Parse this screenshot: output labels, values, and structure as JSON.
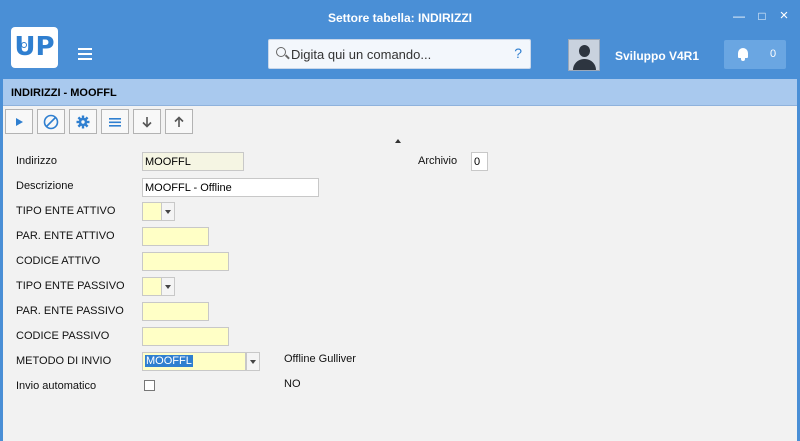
{
  "window": {
    "title": "Settore tabella: INDIRIZZI"
  },
  "header": {
    "logo": "UP",
    "command_placeholder": "Digita qui un comando...",
    "help": "?",
    "user": "Sviluppo V4R1",
    "notifications_count": "0"
  },
  "panel": {
    "title": "INDIRIZZI - MOOFFL"
  },
  "toolbar": {
    "icons": [
      "play-icon",
      "cancel-icon",
      "gear-icon",
      "list-icon",
      "arrow-down-icon",
      "arrow-up-icon"
    ]
  },
  "form": {
    "indirizzo_label": "Indirizzo",
    "indirizzo_value": "MOOFFL",
    "archivio_label": "Archivio",
    "archivio_value": "0",
    "descrizione_label": "Descrizione",
    "descrizione_value": "MOOFFL - Offline",
    "tipo_ente_attivo_label": "TIPO ENTE  ATTIVO",
    "tipo_ente_attivo_value": "",
    "par_ente_attivo_label": "PAR. ENTE  ATTIVO",
    "par_ente_attivo_value": "",
    "codice_attivo_label": "CODICE     ATTIVO",
    "codice_attivo_value": "",
    "tipo_ente_passivo_label": "TIPO ENTE  PASSIVO",
    "tipo_ente_passivo_value": "",
    "par_ente_passivo_label": "PAR. ENTE  PASSIVO",
    "par_ente_passivo_value": "",
    "codice_passivo_label": "CODICE     PASSIVO",
    "codice_passivo_value": "",
    "metodo_invio_label": "METODO DI INVIO",
    "metodo_invio_value": "MOOFFL",
    "metodo_invio_desc": "Offline Gulliver",
    "invio_automatico_label": "Invio automatico",
    "invio_automatico_desc": "NO"
  },
  "colors": {
    "brand_blue": "#4a8fd6",
    "panel_header": "#a9c9ee",
    "field_yellow": "#ffffc6"
  }
}
